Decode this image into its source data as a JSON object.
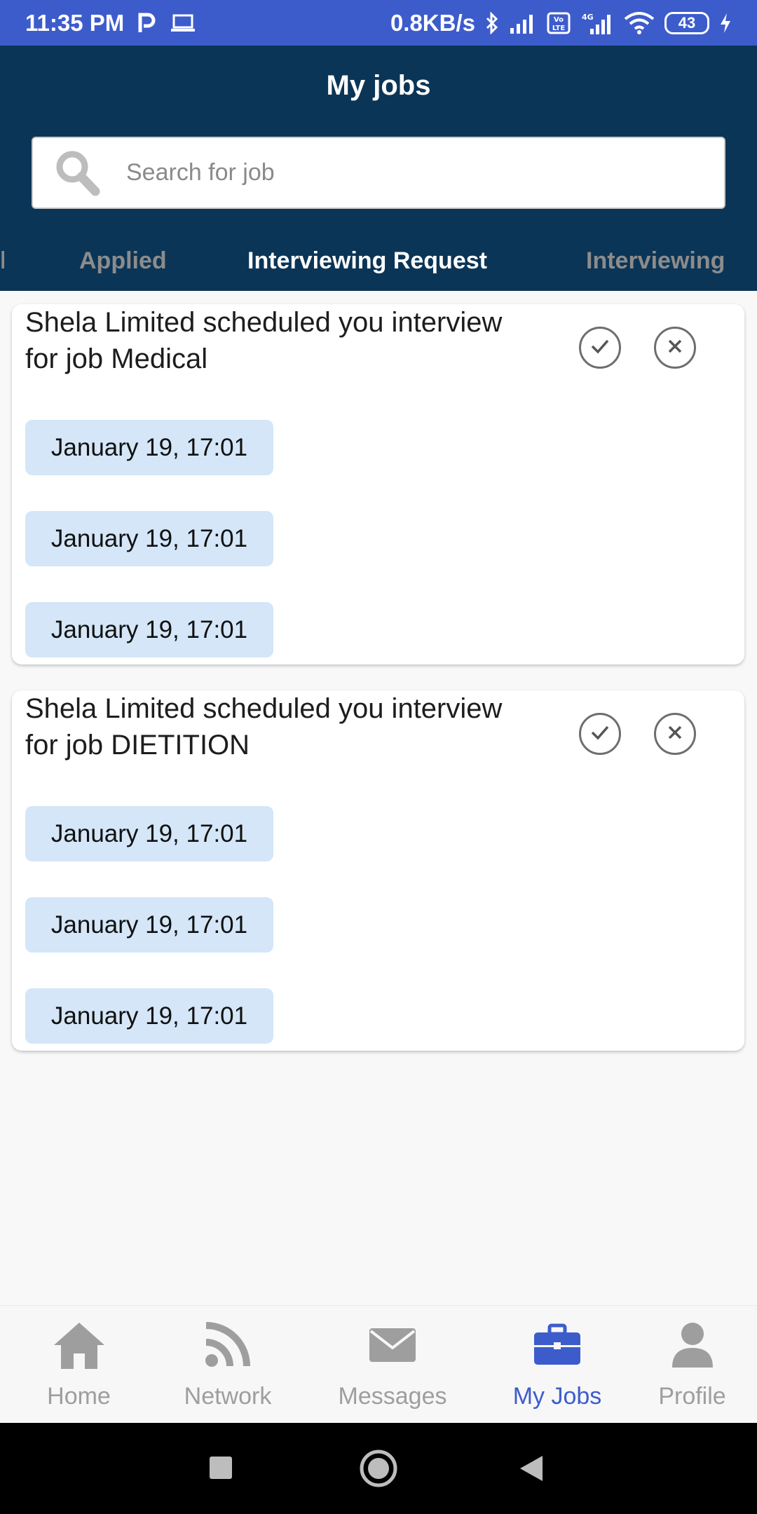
{
  "status_bar": {
    "time": "11:35 PM",
    "network_speed": "0.8KB/s",
    "battery_level": "43",
    "icons": [
      "parking-icon",
      "laptop-icon",
      "bluetooth-icon",
      "signal-icon",
      "volte-icon",
      "4g-signal-icon",
      "wifi-icon",
      "battery-icon",
      "charging-icon"
    ]
  },
  "header": {
    "title": "My jobs",
    "search": {
      "placeholder": "Search for job",
      "value": ""
    }
  },
  "tabs": [
    {
      "label": "Applied",
      "active": false
    },
    {
      "label": "Interviewing Request",
      "active": true
    },
    {
      "label": "Interviewing",
      "active": false
    }
  ],
  "cards": [
    {
      "title": "Shela Limited scheduled you interview for job Medical",
      "dates": [
        "January 19, 17:01",
        "January 19, 17:01",
        "January 19, 17:01"
      ]
    },
    {
      "title": "Shela Limited scheduled you interview for job DIETITION",
      "dates": [
        "January 19, 17:01",
        "January 19, 17:01",
        "January 19, 17:01"
      ]
    }
  ],
  "bottom_nav": [
    {
      "label": "Home",
      "icon": "home-icon",
      "active": false
    },
    {
      "label": "Network",
      "icon": "rss-icon",
      "active": false
    },
    {
      "label": "Messages",
      "icon": "envelope-icon",
      "active": false
    },
    {
      "label": "My Jobs",
      "icon": "briefcase-icon",
      "active": true
    },
    {
      "label": "Profile",
      "icon": "user-icon",
      "active": false
    }
  ],
  "colors": {
    "status_bar": "#3d5ccc",
    "header": "#0b3556",
    "accent": "#3d5ccc",
    "chip": "#d4e6f8",
    "inactive": "#9e9e9e"
  }
}
